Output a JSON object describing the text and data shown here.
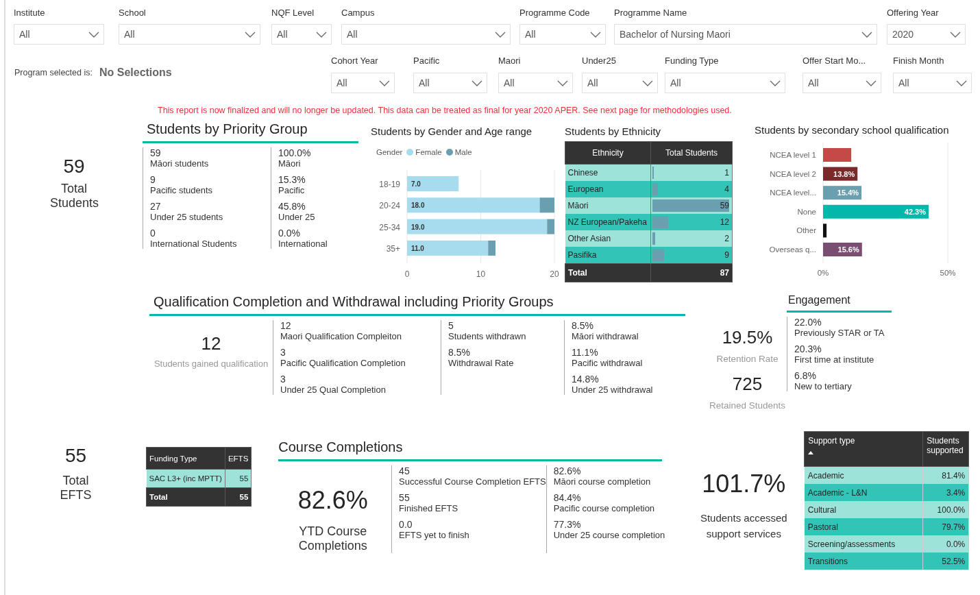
{
  "filters": [
    {
      "label": "Institute",
      "value": "All"
    },
    {
      "label": "School",
      "value": "All"
    },
    {
      "label": "NQF Level",
      "value": "All"
    },
    {
      "label": "Campus",
      "value": "All"
    },
    {
      "label": "Programme Code",
      "value": "All"
    },
    {
      "label": "Programme Name",
      "value": "Bachelor of Nursing Maori"
    },
    {
      "label": "Offering Year",
      "value": "2020"
    }
  ],
  "program_selected": {
    "label": "Program selected is:",
    "value": "No Selections"
  },
  "filters_2": [
    {
      "label": "Cohort Year",
      "value": "All"
    },
    {
      "label": "Pacific",
      "value": "All"
    },
    {
      "label": "Maori",
      "value": "All"
    },
    {
      "label": "Under25",
      "value": "All"
    },
    {
      "label": "Funding Type",
      "value": "All"
    },
    {
      "label": "Offer Start Mo...",
      "value": "All"
    },
    {
      "label": "Finish Month",
      "value": "All"
    }
  ],
  "notice": "This report is now finalized and will no longer be updated. This data can be treated as final for year 2020 APER. See next page for methodologies used.",
  "total_students": {
    "value": "59",
    "label": "Total Students"
  },
  "priority_group": {
    "title": "Students by Priority Group",
    "columns": [
      [
        {
          "value": "59",
          "label": "Māori students"
        },
        {
          "value": "9",
          "label": "Pacific students"
        },
        {
          "value": "27",
          "label": "Under 25 students"
        },
        {
          "value": "0",
          "label": "International Students"
        }
      ],
      [
        {
          "value": "100.0%",
          "label": "Māori"
        },
        {
          "value": "15.3%",
          "label": "Pacific"
        },
        {
          "value": "45.8%",
          "label": "Under 25"
        },
        {
          "value": "0.0%",
          "label": "International"
        }
      ]
    ]
  },
  "gender_age": {
    "title": "Students by Gender and Age range",
    "legend_title": "Gender",
    "chart_data": {
      "type": "bar",
      "orientation": "horizontal",
      "stacked": true,
      "categories": [
        "18-19",
        "20-24",
        "25-34",
        "35+"
      ],
      "series": [
        {
          "name": "Female",
          "color": "#a6dcee",
          "values": [
            7,
            18,
            19,
            11
          ]
        },
        {
          "name": "Male",
          "color": "#6a9fb0",
          "values": [
            0,
            2,
            1,
            1
          ]
        }
      ],
      "xlim": [
        0,
        20
      ],
      "xticks": [
        0,
        10,
        20
      ],
      "value_labels": [
        "7.0",
        "18.0",
        "19.0",
        "11.0"
      ]
    }
  },
  "ethnicity": {
    "title": "Students by Ethnicity",
    "columns": [
      "Ethnicity",
      "Total Students"
    ],
    "rows": [
      {
        "name": "Chinese",
        "total": "1",
        "level": 0.017
      },
      {
        "name": "European",
        "total": "4",
        "level": 0.068
      },
      {
        "name": "Māori",
        "total": "59",
        "level": 1
      },
      {
        "name": "NZ European/Pakeha",
        "total": "12",
        "level": 0.203
      },
      {
        "name": "Other Asian",
        "total": "2",
        "level": 0.034
      },
      {
        "name": "Pasifika",
        "total": "9",
        "level": 0.153
      }
    ],
    "total": {
      "label": "Total",
      "value": "87"
    }
  },
  "secondary_qualification": {
    "title": "Students by secondary school qualification",
    "chart_data": {
      "type": "bar",
      "orientation": "horizontal",
      "categories": [
        "NCEA level 1",
        "NCEA level 2",
        "NCEA level...",
        "None",
        "Other",
        "Overseas q..."
      ],
      "values": [
        11.3,
        13.8,
        15.4,
        42.3,
        1.4,
        15.6
      ],
      "colors": [
        "#c44a48",
        "#7a2a2a",
        "#6a9fb0",
        "#01b8aa",
        "#111111",
        "#7a4e72"
      ],
      "xlim": [
        0,
        50
      ],
      "xticks": [
        {
          "value": 0,
          "label": "0%"
        },
        {
          "value": 50,
          "label": "50%"
        }
      ],
      "value_labels": [
        null,
        "13.8%",
        "15.4%",
        "42.3%",
        null,
        "15.6%"
      ]
    }
  },
  "qualification": {
    "title": "Qualification Completion and Withdrawal including Priority Groups",
    "kpi": {
      "value": "12",
      "label": "Students gained qualification"
    },
    "columns": [
      [
        {
          "value": "12",
          "label": "Maori Qualification Compleiton"
        },
        {
          "value": "3",
          "label": "Pacific Qualification Completion"
        },
        {
          "value": "3",
          "label": "Under 25 Qual Completion"
        }
      ],
      [
        {
          "value": "5",
          "label": "Students withdrawn"
        },
        {
          "value": "8.5%",
          "label": "Withdrawal Rate"
        }
      ],
      [
        {
          "value": "8.5%",
          "label": "Māori withdrawal"
        },
        {
          "value": "11.1%",
          "label": "Pacific withdrawal"
        },
        {
          "value": "14.8%",
          "label": "Under 25 withdrawal"
        }
      ]
    ]
  },
  "retention": [
    {
      "value": "19.5%",
      "label": "Retention Rate"
    },
    {
      "value": "725",
      "label": "Retained Students"
    }
  ],
  "engagement": {
    "title": "Engagement",
    "items": [
      {
        "value": "22.0%",
        "label": "Previously STAR or TA"
      },
      {
        "value": "20.3%",
        "label": "First time at institute"
      },
      {
        "value": "6.8%",
        "label": "New to tertiary"
      }
    ]
  },
  "total_efts": {
    "value": "55",
    "label": "Total EFTS"
  },
  "funding_table": {
    "columns": [
      "Funding Type",
      "EFTS"
    ],
    "rows": [
      {
        "type": "SAC L3+ (inc MPTT)",
        "efts": "55"
      }
    ],
    "total": {
      "label": "Total",
      "value": "55"
    }
  },
  "course_completions": {
    "title": "Course Completions",
    "kpi": {
      "value": "82.6%",
      "label": "YTD Course Completions"
    },
    "columns": [
      [
        {
          "value": "45",
          "label": "Successful Course Completion EFTS"
        },
        {
          "value": "55",
          "label": "Finished EFTS"
        },
        {
          "value": "0.0",
          "label": "EFTS yet to finish"
        }
      ],
      [
        {
          "value": "82.6%",
          "label": "Māori course completion"
        },
        {
          "value": "84.4%",
          "label": "Pacific course completion"
        },
        {
          "value": "77.3%",
          "label": "Under 25 course completion"
        }
      ]
    ]
  },
  "support": {
    "kpi": {
      "value": "101.7%",
      "label": "Students accessed support services"
    },
    "columns": [
      {
        "label": "Support type",
        "sorted": true
      },
      {
        "label": "Students supported",
        "sorted": false
      }
    ],
    "rows": [
      {
        "type": "Academic",
        "value": "81.4%"
      },
      {
        "type": "Academic - L&N",
        "value": "3.4%"
      },
      {
        "type": "Cultural",
        "value": "100.0%"
      },
      {
        "type": "Pastoral",
        "value": "79.7%"
      },
      {
        "type": "Screening/assessments",
        "value": "0.0%"
      },
      {
        "type": "Transitions",
        "value": "52.5%"
      }
    ]
  }
}
